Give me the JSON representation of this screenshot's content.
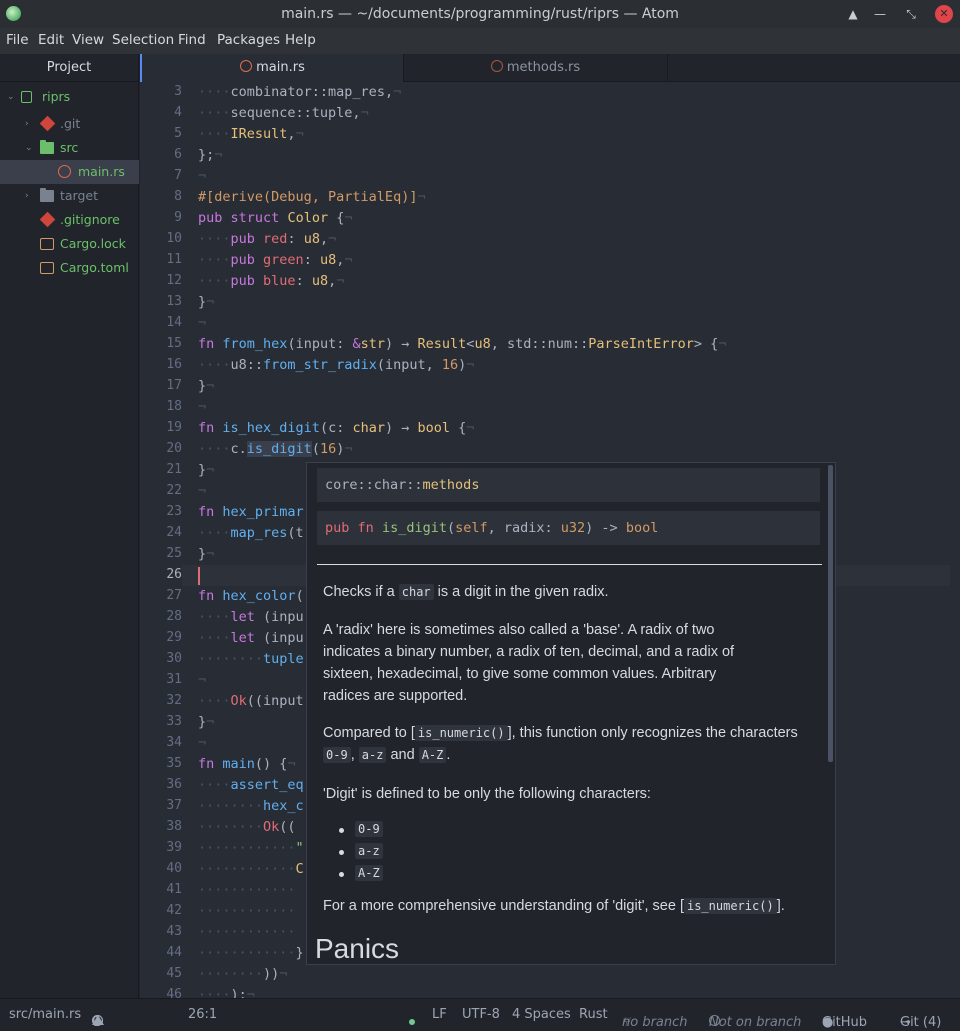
{
  "window": {
    "title": "main.rs — ~/documents/programming/rust/riprs — Atom"
  },
  "menu": [
    "File",
    "Edit",
    "View",
    "Selection",
    "Find",
    "Packages",
    "Help"
  ],
  "tree": {
    "panel_title": "Project",
    "items": [
      {
        "label": "riprs",
        "kind": "root",
        "color": "#6cbf6a"
      },
      {
        "label": ".git",
        "kind": "git",
        "color": "#7a8290"
      },
      {
        "label": "src",
        "kind": "folder-open",
        "color": "#6cbf6a"
      },
      {
        "label": "main.rs",
        "kind": "rust-file",
        "color": "#6cbf6a"
      },
      {
        "label": "target",
        "kind": "folder",
        "color": "#7a8290"
      },
      {
        "label": ".gitignore",
        "kind": "git",
        "color": "#6cbf6a"
      },
      {
        "label": "Cargo.lock",
        "kind": "crate",
        "color": "#6cbf6a"
      },
      {
        "label": "Cargo.toml",
        "kind": "crate",
        "color": "#6cbf6a"
      }
    ]
  },
  "tabs": [
    {
      "label": "main.rs",
      "active": true
    },
    {
      "label": "methods.rs",
      "active": false
    }
  ],
  "editor": {
    "line_numbers": [
      "3",
      "4",
      "5",
      "6",
      "7",
      "8",
      "9",
      "10",
      "11",
      "12",
      "13",
      "14",
      "15",
      "16",
      "17",
      "18",
      "19",
      "20",
      "21",
      "22",
      "23",
      "24",
      "25",
      "26",
      "27",
      "28",
      "29",
      "30",
      "31",
      "32",
      "33",
      "34",
      "35",
      "36",
      "37",
      "38",
      "39",
      "40",
      "41",
      "42",
      "43",
      "44",
      "45",
      "46"
    ],
    "current_line": "26"
  },
  "popup": {
    "path_prefix": "core::char::",
    "path_name": "methods",
    "signature": {
      "kw1": "pub",
      "kw2": "fn",
      "name": "is_digit",
      "open": "(",
      "self": "self",
      "rest": ", radix: ",
      "type": "u32",
      "arrow": ") -> ",
      "ret": "bool"
    },
    "p1_a": "Checks if a ",
    "p1_code": "char",
    "p1_b": " is a digit in the given radix.",
    "p2": [
      "A 'radix' here is sometimes also called a 'base'. A radix of two",
      "indicates a binary number, a radix of ten, decimal, and a radix of",
      "sixteen, hexadecimal, to give some common values. Arbitrary",
      "radices are supported."
    ],
    "p3_a": "Compared to [",
    "p3_code": "is_numeric()",
    "p3_b": "], this function only recognizes the characters",
    "p3_c1": "0-9",
    "p3_sep1": ", ",
    "p3_c2": "a-z",
    "p3_sep2": " and ",
    "p3_c3": "A-Z",
    "p3_end": ".",
    "p4": "'Digit' is defined to be only the following characters:",
    "list": [
      "0-9",
      "a-z",
      "A-Z"
    ],
    "p5_a": "For a more comprehensive understanding of 'digit', see [",
    "p5_code": "is_numeric()",
    "p5_b": "].",
    "heading": "Panics"
  },
  "status": {
    "file": "src/main.rs",
    "errors": "0",
    "warnings": "0",
    "infos": "0",
    "position": "26:1",
    "line_ending": "LF",
    "encoding": "UTF-8",
    "indent": "4 Spaces",
    "grammar": "Rust",
    "branch": "no branch",
    "not_on_branch": "Not on branch",
    "github": "GitHub",
    "git": "Git (4)"
  },
  "colors": {
    "accent": "#568af2",
    "editor_bg": "#282c34",
    "panel_bg": "#21252b",
    "git_added": "#6cbf6a",
    "cursor": "#e06c75"
  }
}
